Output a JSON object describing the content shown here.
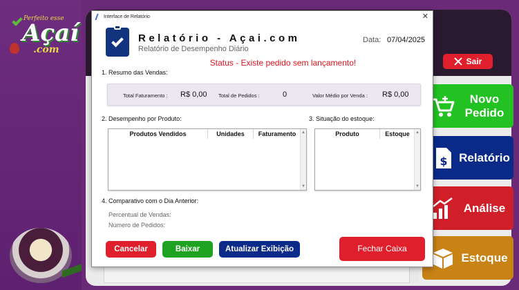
{
  "app": {
    "logo_tagline": "Perfeito esse",
    "logo_word": "Açaí",
    "logo_suffix": ".com",
    "sair_label": "Sair",
    "side_buttons": [
      {
        "label1": "Novo",
        "label2": "Pedido",
        "icon": "cart-plus-icon"
      },
      {
        "label1": "Relatório",
        "label2": "",
        "icon": "document-dollar-icon"
      },
      {
        "label1": "Análise",
        "label2": "",
        "icon": "bar-chart-icon"
      },
      {
        "label1": "Estoque",
        "label2": "",
        "icon": "box-icon"
      }
    ]
  },
  "dialog": {
    "window_title": "Interface de Relatório",
    "close_glyph": "✕",
    "title": "Relatório - Açai.com",
    "subtitle": "Relatório de Desempenho Diário",
    "date_label": "Data:",
    "date_value": "07/04/2025",
    "status": "Status - Existe pedido sem lançamento!",
    "summary": {
      "section_title": "1. Resumo das Vendas:",
      "total_faturamento_label": "Total Faturamento :",
      "total_faturamento_value": "R$ 0,00",
      "total_pedidos_label": "Total de Pedidos :",
      "total_pedidos_value": "0",
      "valor_medio_label": "Valor Médio por Venda :",
      "valor_medio_value": "R$ 0,00"
    },
    "products": {
      "section_title": "2. Desempenho por Produto:",
      "columns": [
        "Produtos Vendidos",
        "Unidades",
        "Faturamento"
      ]
    },
    "stock": {
      "section_title": "3. Situação do estoque:",
      "columns": [
        "Produto",
        "Estoque"
      ]
    },
    "comparison": {
      "section_title": "4. Comparativo com o Dia Anterior:",
      "percent_label": "Percentual de Vendas:",
      "orders_label": "Número de Pedidos:"
    },
    "buttons": {
      "cancel": "Cancelar",
      "download": "Baixar",
      "refresh": "Atualizar Exibição",
      "close_register": "Fechar Caixa"
    }
  }
}
